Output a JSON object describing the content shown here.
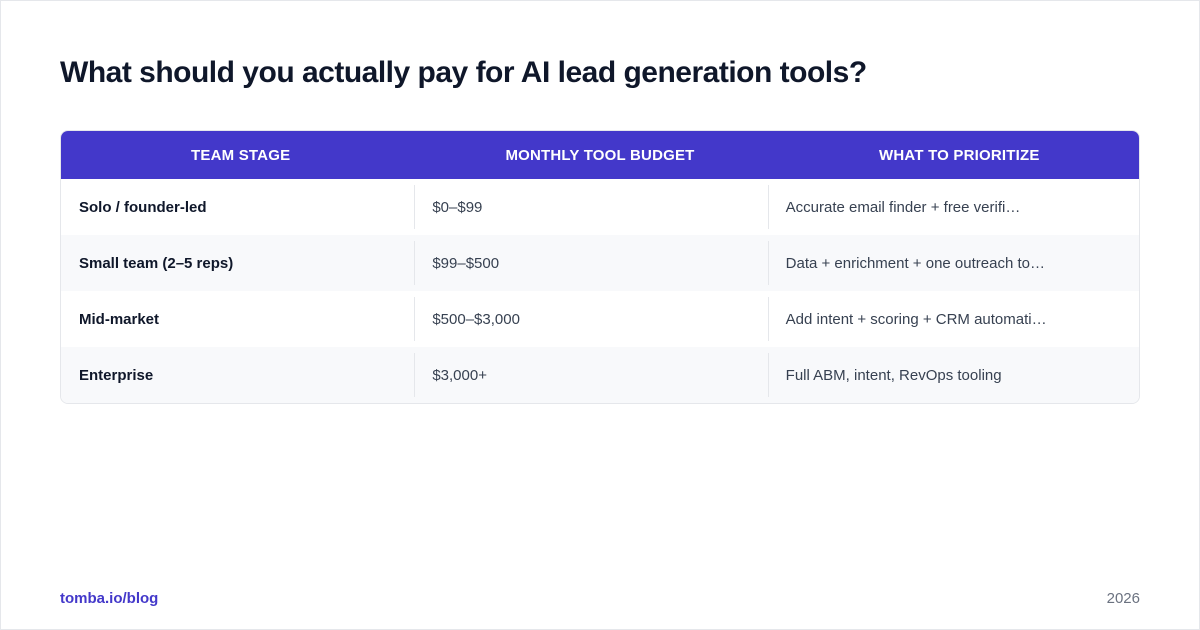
{
  "title": "What should you actually pay for AI lead generation tools?",
  "table": {
    "headers": [
      "TEAM STAGE",
      "MONTHLY TOOL BUDGET",
      "WHAT TO PRIORITIZE"
    ],
    "rows": [
      [
        "Solo / founder-led",
        "$0–$99",
        "Accurate email finder + free verifi…"
      ],
      [
        "Small team (2–5 reps)",
        "$99–$500",
        "Data + enrichment + one outreach to…"
      ],
      [
        "Mid-market",
        "$500–$3,000",
        "Add intent + scoring + CRM automati…"
      ],
      [
        "Enterprise",
        "$3,000+",
        "Full ABM, intent, RevOps tooling"
      ]
    ]
  },
  "footer": {
    "source": "tomba.io/blog",
    "year": "2026"
  },
  "colors": {
    "header_bg": "#4338ca",
    "accent": "#4338ca"
  }
}
